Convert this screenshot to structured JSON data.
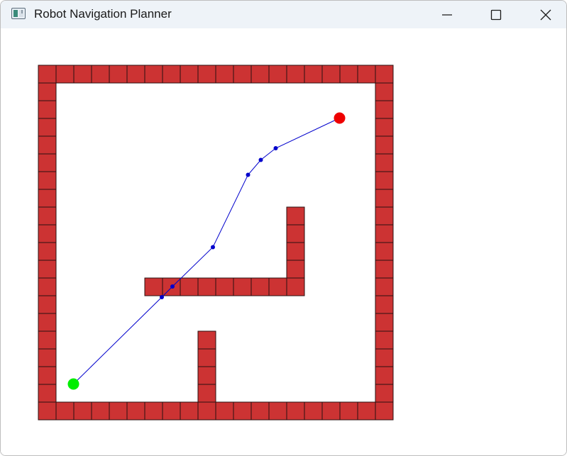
{
  "window": {
    "title": "Robot Navigation Planner",
    "buttons": {
      "minimize": "minimize-icon",
      "maximize": "maximize-icon",
      "close": "close-icon"
    }
  },
  "map": {
    "rows": 20,
    "cols": 20,
    "wall_color": "#cc3333",
    "wall_border_color": "#2a1010",
    "path_color": "#0000cc",
    "start_color": "#00ee00",
    "goal_color": "#ee0000",
    "walls": [
      [
        0,
        0
      ],
      [
        0,
        1
      ],
      [
        0,
        2
      ],
      [
        0,
        3
      ],
      [
        0,
        4
      ],
      [
        0,
        5
      ],
      [
        0,
        6
      ],
      [
        0,
        7
      ],
      [
        0,
        8
      ],
      [
        0,
        9
      ],
      [
        0,
        10
      ],
      [
        0,
        11
      ],
      [
        0,
        12
      ],
      [
        0,
        13
      ],
      [
        0,
        14
      ],
      [
        0,
        15
      ],
      [
        0,
        16
      ],
      [
        0,
        17
      ],
      [
        0,
        18
      ],
      [
        0,
        19
      ],
      [
        19,
        0
      ],
      [
        19,
        1
      ],
      [
        19,
        2
      ],
      [
        19,
        3
      ],
      [
        19,
        4
      ],
      [
        19,
        5
      ],
      [
        19,
        6
      ],
      [
        19,
        7
      ],
      [
        19,
        8
      ],
      [
        19,
        9
      ],
      [
        19,
        10
      ],
      [
        19,
        11
      ],
      [
        19,
        12
      ],
      [
        19,
        13
      ],
      [
        19,
        14
      ],
      [
        19,
        15
      ],
      [
        19,
        16
      ],
      [
        19,
        17
      ],
      [
        19,
        18
      ],
      [
        19,
        19
      ],
      [
        1,
        0
      ],
      [
        2,
        0
      ],
      [
        3,
        0
      ],
      [
        4,
        0
      ],
      [
        5,
        0
      ],
      [
        6,
        0
      ],
      [
        7,
        0
      ],
      [
        8,
        0
      ],
      [
        9,
        0
      ],
      [
        10,
        0
      ],
      [
        11,
        0
      ],
      [
        12,
        0
      ],
      [
        13,
        0
      ],
      [
        14,
        0
      ],
      [
        15,
        0
      ],
      [
        16,
        0
      ],
      [
        17,
        0
      ],
      [
        18,
        0
      ],
      [
        1,
        19
      ],
      [
        2,
        19
      ],
      [
        3,
        19
      ],
      [
        4,
        19
      ],
      [
        5,
        19
      ],
      [
        6,
        19
      ],
      [
        7,
        19
      ],
      [
        8,
        19
      ],
      [
        9,
        19
      ],
      [
        10,
        19
      ],
      [
        11,
        19
      ],
      [
        12,
        19
      ],
      [
        13,
        19
      ],
      [
        14,
        19
      ],
      [
        15,
        19
      ],
      [
        16,
        19
      ],
      [
        17,
        19
      ],
      [
        18,
        19
      ],
      [
        6,
        12
      ],
      [
        7,
        12
      ],
      [
        8,
        12
      ],
      [
        9,
        12
      ],
      [
        10,
        12
      ],
      [
        11,
        12
      ],
      [
        12,
        12
      ],
      [
        13,
        12
      ],
      [
        14,
        12
      ],
      [
        14,
        8
      ],
      [
        14,
        9
      ],
      [
        14,
        10
      ],
      [
        14,
        11
      ],
      [
        9,
        15
      ],
      [
        9,
        16
      ],
      [
        9,
        17
      ],
      [
        9,
        18
      ]
    ],
    "path": [
      [
        1.98,
        17.98
      ],
      [
        6.96,
        13.08
      ],
      [
        7.56,
        12.48
      ],
      [
        9.84,
        10.26
      ],
      [
        11.82,
        6.18
      ],
      [
        12.54,
        5.34
      ],
      [
        13.38,
        4.68
      ],
      [
        16.98,
        2.98
      ]
    ],
    "start": [
      1.98,
      17.98
    ],
    "goal": [
      16.98,
      2.98
    ]
  }
}
